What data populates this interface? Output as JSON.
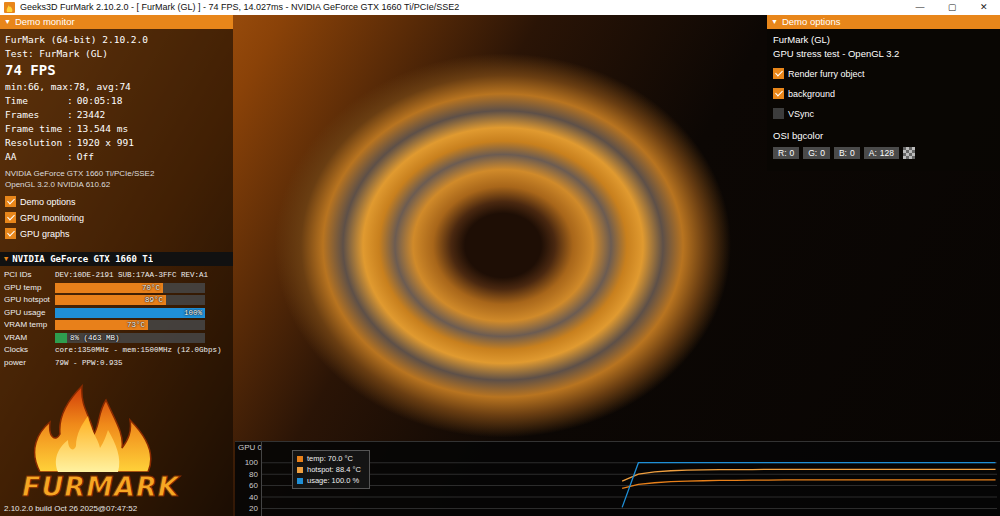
{
  "window": {
    "title": "Geeks3D FurMark 2.10.2.0 - [ FurMark (GL) ] - 74 FPS, 14.027ms - NVIDIA GeForce GTX 1660 Ti/PCIe/SSE2",
    "controls": [
      "—",
      "▢",
      "✕"
    ]
  },
  "monitor": {
    "header": {
      "icon": "▼",
      "title": "Demo monitor"
    },
    "app": "FurMark (64-bit) 2.10.2.0",
    "test": "Test: FurMark (GL)",
    "fps": "74 FPS",
    "fps_stats": "min:66, max:78, avg:74",
    "separator": ":",
    "stats": [
      {
        "label": "Time",
        "value": "00:05:18"
      },
      {
        "label": "Frames",
        "value": "23442"
      },
      {
        "label": "Frame time",
        "value": "13.544 ms"
      },
      {
        "label": "Resolution",
        "value": "1920 x 991"
      },
      {
        "label": "AA",
        "value": "Off"
      }
    ],
    "renderer": "NVIDIA GeForce GTX 1660 Ti/PCIe/SSE2",
    "opengl": "OpenGL 3.2.0 NVIDIA 610.62",
    "toggles": [
      {
        "label": "Demo options",
        "checked": true
      },
      {
        "label": "GPU monitoring",
        "checked": true
      },
      {
        "label": "GPU graphs",
        "checked": true
      }
    ]
  },
  "gpu": {
    "header": {
      "icon": "▼",
      "title": "NVIDIA GeForce GTX 1660 Ti"
    },
    "rows": [
      {
        "kind": "text",
        "label": "PCI IDs",
        "value": "DEV:10DE-2191 SUB:17AA-3FFC REV:A1"
      },
      {
        "kind": "bar",
        "label": "GPU temp",
        "reading": "70°C",
        "level": 0.72,
        "color": "#e8801a"
      },
      {
        "kind": "bar",
        "label": "GPU hotspot",
        "reading": "89°C",
        "level": 0.74,
        "color": "#e8801a"
      },
      {
        "kind": "bar",
        "label": "GPU usage",
        "reading": "100%",
        "level": 1.0,
        "color": "#1f8fd6"
      },
      {
        "kind": "bar",
        "label": "VRAM temp",
        "reading": "73°C",
        "level": 0.62,
        "color": "#e8801a"
      },
      {
        "kind": "bar",
        "label": "VRAM",
        "reading": "8% (463 MB)",
        "level": 0.08,
        "color": "#2e9e4f"
      },
      {
        "kind": "text",
        "label": "Clocks",
        "value": "core:1350MHz - mem:1500MHz (12.0Gbps)"
      },
      {
        "kind": "text",
        "label": "power",
        "value": "79W - PPW:0.935"
      }
    ]
  },
  "logo": {
    "text": "FURMARK"
  },
  "build": "2.10.2.0 build Oct 26 2025@07:47:52",
  "options": {
    "header": {
      "icon": "▼",
      "title": "Demo options"
    },
    "demo": "FurMark (GL)",
    "description": "GPU stress test - OpenGL 3.2",
    "toggles": [
      {
        "label": "Render furry object",
        "checked": true
      },
      {
        "label": "background",
        "checked": true
      },
      {
        "label": "VSync",
        "checked": false
      }
    ],
    "bgcolor_label": "OSI bgcolor",
    "bgcolor": [
      {
        "label": "R:",
        "value": "0"
      },
      {
        "label": "G:",
        "value": "0"
      },
      {
        "label": "B:",
        "value": "0"
      },
      {
        "label": "A:",
        "value": "128"
      }
    ]
  },
  "graph": {
    "title": "GPU 0",
    "ticks": [
      "100",
      "80",
      "60",
      "40",
      "20"
    ],
    "series": [
      {
        "legend": "temp: 70.0 °C",
        "color": "#e8801a",
        "values": [
          55,
          62,
          65,
          67,
          68,
          68.5,
          69,
          69,
          69.5,
          69.5,
          70,
          70,
          70,
          70,
          70,
          70,
          70,
          70,
          70,
          70,
          70,
          70,
          70,
          70
        ]
      },
      {
        "legend": "hotspot: 88.4 °C",
        "color": "#f0a040",
        "values": [
          68,
          80,
          84,
          86,
          87,
          87.5,
          88,
          88,
          88,
          88.4,
          88.4,
          88.4,
          88.4,
          88.4,
          88.4,
          88.4,
          88.4,
          88.4,
          88.4,
          88.4,
          88.4,
          88.4,
          88.4,
          88.4
        ]
      },
      {
        "legend": "usage: 100.0 %",
        "color": "#1f8fd6",
        "values": [
          22,
          100,
          100,
          100,
          100,
          100,
          100,
          100,
          100,
          100,
          100,
          100,
          100,
          100,
          100,
          100,
          100,
          100,
          100,
          100,
          100,
          100,
          100,
          100
        ]
      }
    ]
  }
}
